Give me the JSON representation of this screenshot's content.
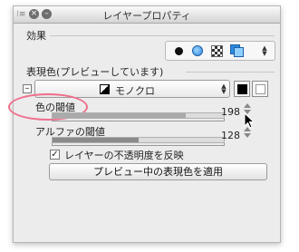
{
  "window": {
    "title": "レイヤープロパティ"
  },
  "effects": {
    "label": "効果"
  },
  "expression": {
    "label": "表現色(プレビューしています)",
    "mode": "モノクロ"
  },
  "threshold": {
    "label": "色の閾値",
    "value": "198",
    "fraction": 0.78
  },
  "alpha_threshold": {
    "label": "アルファの閾値",
    "value": "128",
    "fraction": 0.5
  },
  "reflect_opacity": {
    "label": "レイヤーの不透明度を反映",
    "checked": true,
    "mark": "✓"
  },
  "apply_button": {
    "label": "プレビュー中の表現色を適用"
  },
  "colors": {
    "highlight": "#ef6f8c",
    "accent_blue": "#2f8ae0"
  }
}
